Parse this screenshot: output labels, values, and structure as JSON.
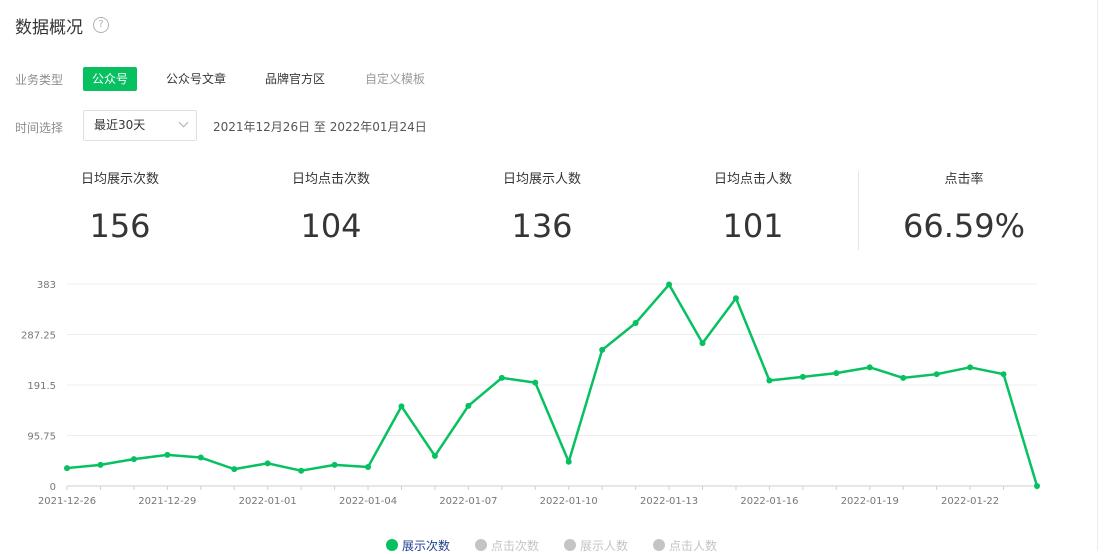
{
  "header": {
    "title": "数据概况",
    "help_glyph": "?"
  },
  "filters": {
    "business_label": "业务类型",
    "tabs": [
      {
        "label": "公众号",
        "state": "active"
      },
      {
        "label": "公众号文章",
        "state": "normal"
      },
      {
        "label": "品牌官方区",
        "state": "normal"
      },
      {
        "label": "自定义模板",
        "state": "muted"
      }
    ],
    "time_label": "时间选择",
    "time_select_value": "最近30天",
    "date_range": "2021年12月26日 至 2022年01月24日"
  },
  "stats": [
    {
      "label": "日均展示次数",
      "value": "156"
    },
    {
      "label": "日均点击次数",
      "value": "104"
    },
    {
      "label": "日均展示人数",
      "value": "136"
    },
    {
      "label": "日均点击人数",
      "value": "101"
    },
    {
      "label": "点击率",
      "value": "66.59%"
    }
  ],
  "colors": {
    "accent": "#07c160",
    "inactive": "#c4c4c4"
  },
  "chart_data": {
    "type": "line",
    "title": "",
    "xlabel": "",
    "ylabel": "",
    "ylim": [
      0,
      383
    ],
    "yticks": [
      "0",
      "95.75",
      "191.5",
      "287.25",
      "383"
    ],
    "xtick_labels": [
      "2021-12-26",
      "2021-12-29",
      "2022-01-01",
      "2022-01-04",
      "2022-01-07",
      "2022-01-10",
      "2022-01-13",
      "2022-01-16",
      "2022-01-19",
      "2022-01-22"
    ],
    "x": [
      "2021-12-26",
      "2021-12-27",
      "2021-12-28",
      "2021-12-29",
      "2021-12-30",
      "2021-12-31",
      "2022-01-01",
      "2022-01-02",
      "2022-01-03",
      "2022-01-04",
      "2022-01-05",
      "2022-01-06",
      "2022-01-07",
      "2022-01-08",
      "2022-01-09",
      "2022-01-10",
      "2022-01-11",
      "2022-01-12",
      "2022-01-13",
      "2022-01-14",
      "2022-01-15",
      "2022-01-16",
      "2022-01-17",
      "2022-01-18",
      "2022-01-19",
      "2022-01-20",
      "2022-01-21",
      "2022-01-22",
      "2022-01-23",
      "2022-01-24"
    ],
    "grid": true,
    "legend_position": "bottom",
    "series": [
      {
        "name": "展示次数",
        "active": true,
        "values": [
          34,
          40,
          51,
          59,
          54,
          32,
          43,
          29,
          40,
          36,
          151,
          57,
          152,
          205,
          196,
          46,
          258,
          309,
          382,
          271,
          356,
          200,
          207,
          214,
          225,
          205,
          212,
          225,
          212,
          0
        ]
      },
      {
        "name": "点击次数",
        "active": false
      },
      {
        "name": "展示人数",
        "active": false
      },
      {
        "name": "点击人数",
        "active": false
      }
    ]
  }
}
